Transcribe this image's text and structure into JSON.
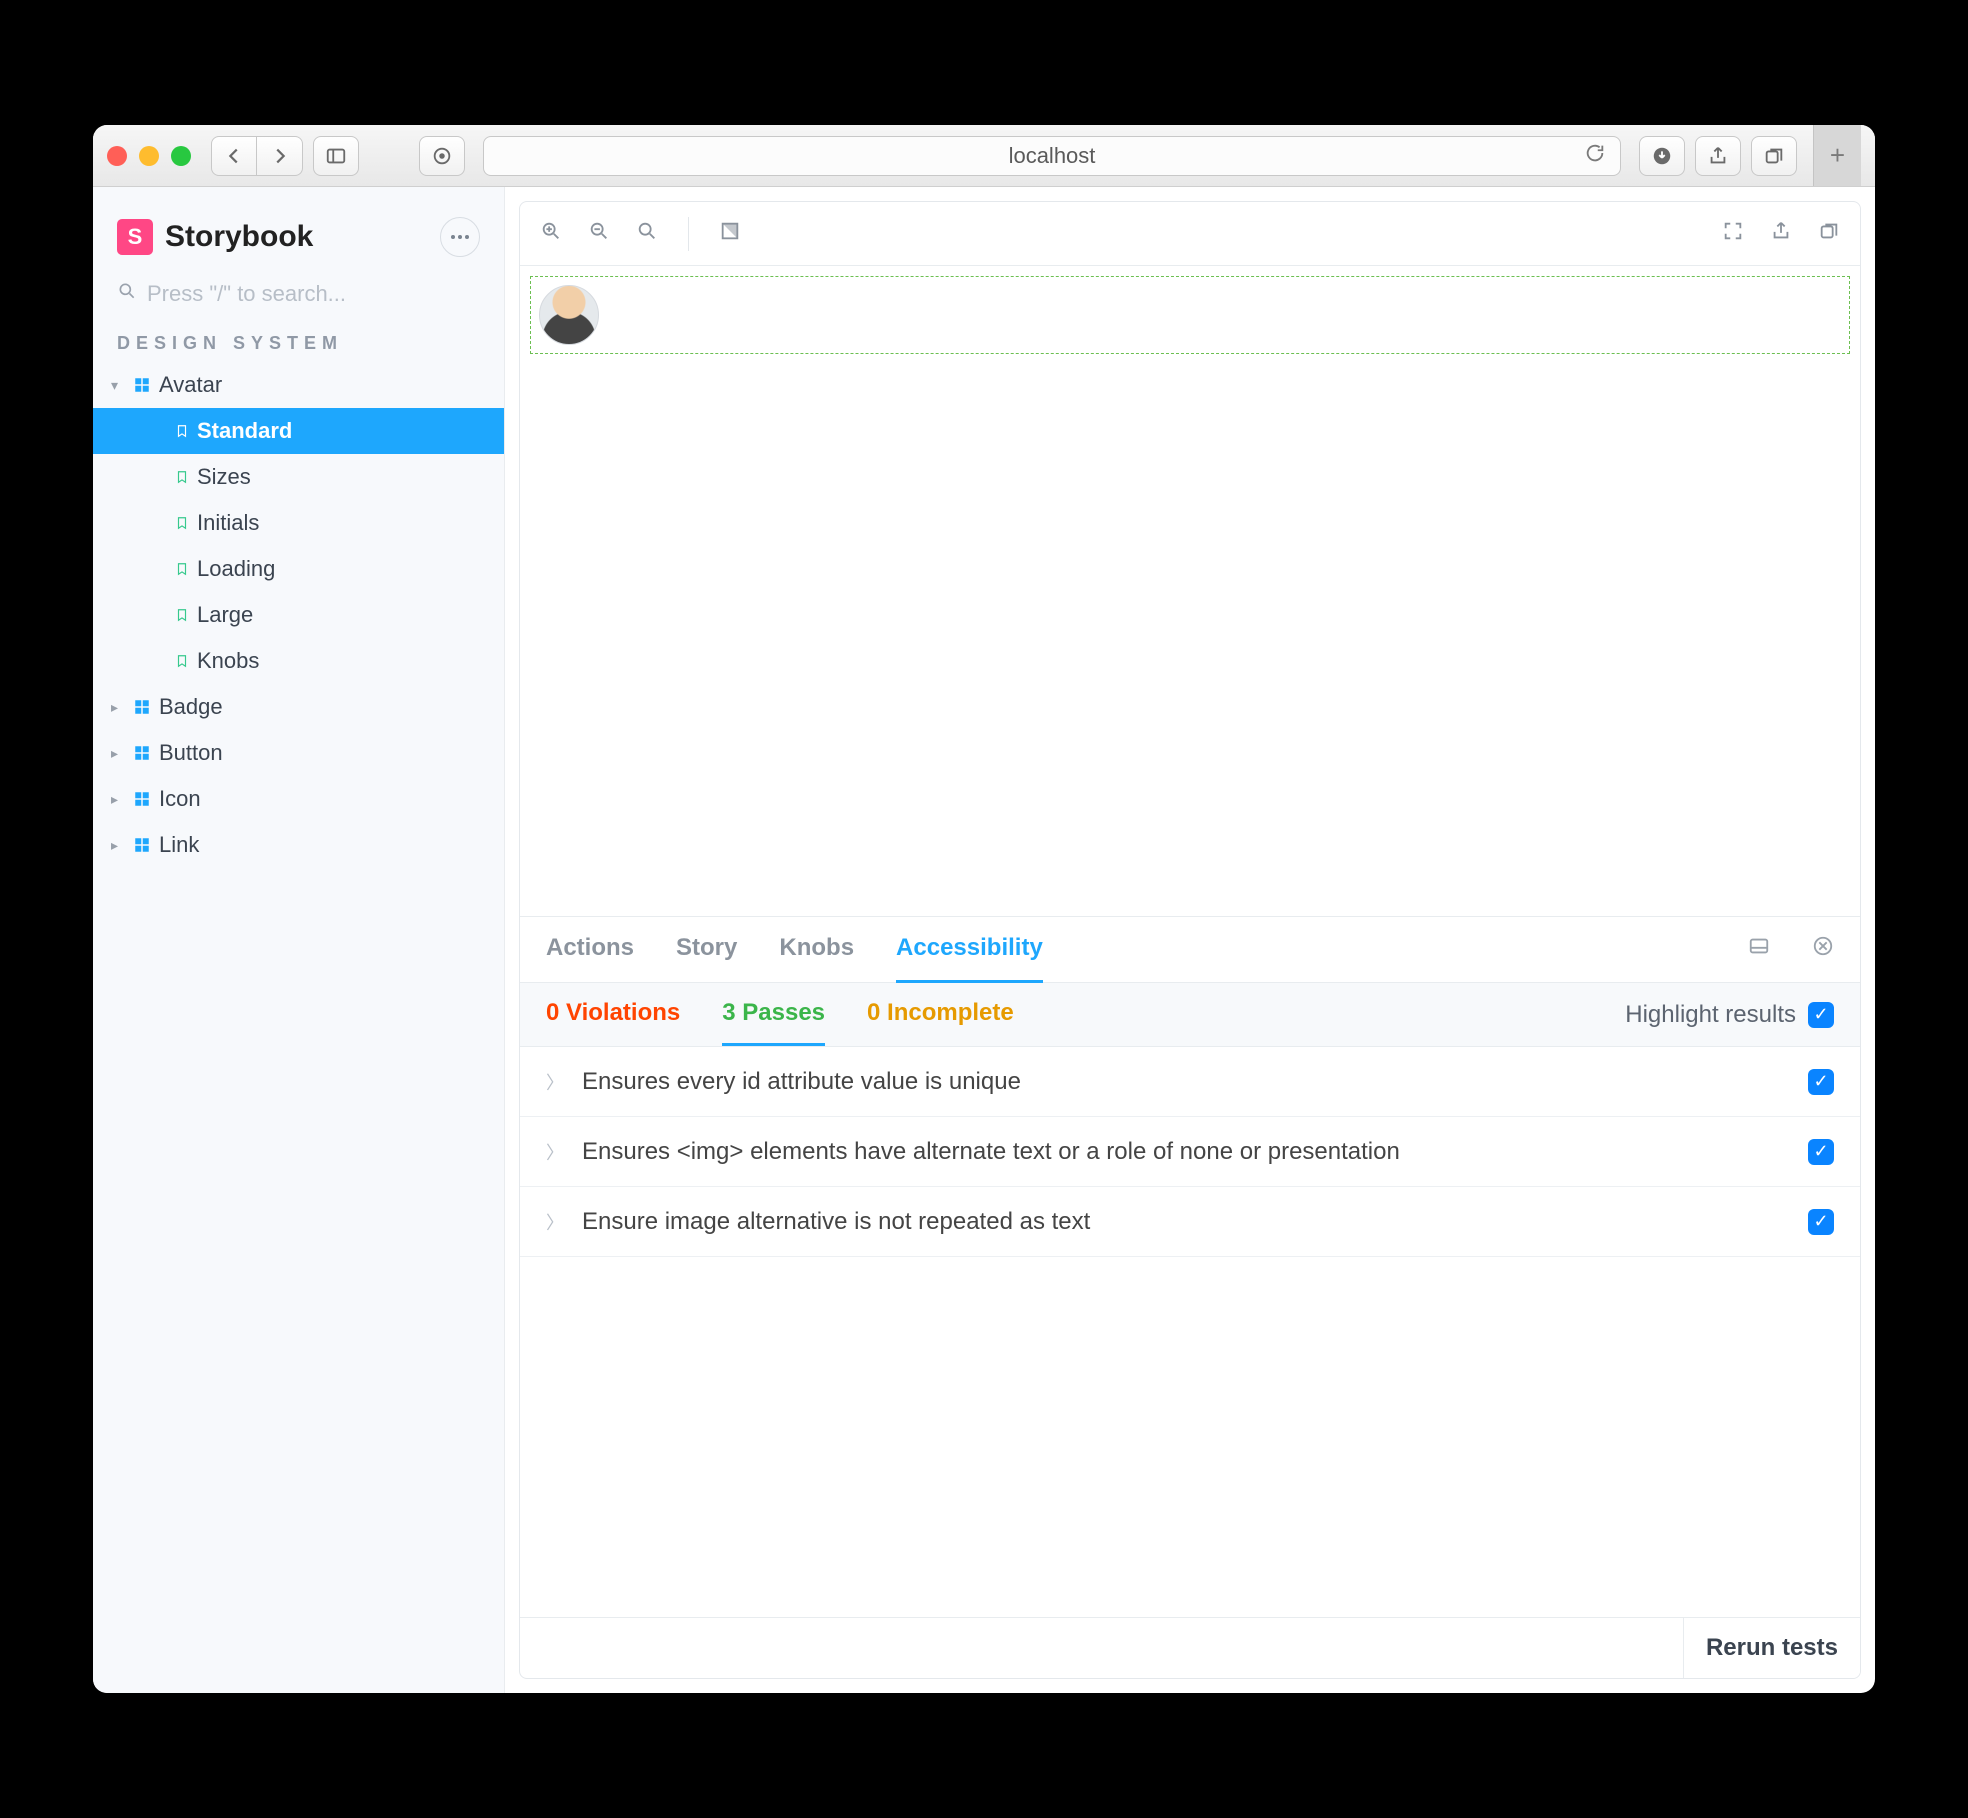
{
  "browser": {
    "url": "localhost"
  },
  "app": {
    "title": "Storybook",
    "search_placeholder": "Press \"/\" to search...",
    "section": "Design System"
  },
  "tree": {
    "components": [
      {
        "name": "Avatar",
        "expanded": true,
        "stories": [
          {
            "name": "Standard",
            "selected": true
          },
          {
            "name": "Sizes",
            "selected": false
          },
          {
            "name": "Initials",
            "selected": false
          },
          {
            "name": "Loading",
            "selected": false
          },
          {
            "name": "Large",
            "selected": false
          },
          {
            "name": "Knobs",
            "selected": false
          }
        ]
      },
      {
        "name": "Badge",
        "expanded": false,
        "stories": []
      },
      {
        "name": "Button",
        "expanded": false,
        "stories": []
      },
      {
        "name": "Icon",
        "expanded": false,
        "stories": []
      },
      {
        "name": "Link",
        "expanded": false,
        "stories": []
      }
    ]
  },
  "addons": {
    "tabs": [
      "Actions",
      "Story",
      "Knobs",
      "Accessibility"
    ],
    "active_tab": "Accessibility"
  },
  "a11y": {
    "violations_label": "0 Violations",
    "passes_label": "3 Passes",
    "incomplete_label": "0 Incomplete",
    "highlight_label": "Highlight results",
    "results": [
      "Ensures every id attribute value is unique",
      "Ensures <img> elements have alternate text or a role of none or presentation",
      "Ensure image alternative is not repeated as text"
    ],
    "rerun_label": "Rerun tests"
  }
}
